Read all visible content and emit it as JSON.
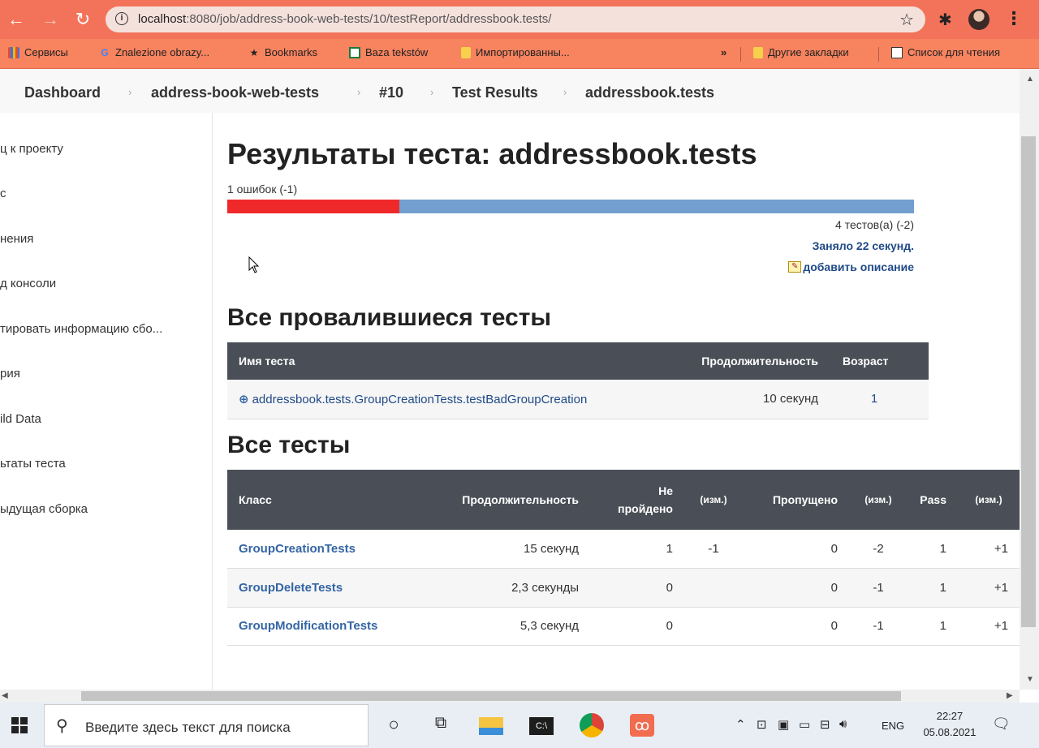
{
  "browser": {
    "url_host": "localhost",
    "url_rest": ":8080/job/address-book-web-tests/10/testReport/addressbook.tests/",
    "bookmarks": {
      "apps": "Сервисы",
      "znalezione": "Znalezione obrazy...",
      "bookmarks": "Bookmarks",
      "baza": "Baza tekstów",
      "imported": "Импортированны...",
      "more": "»",
      "other": "Другие закладки",
      "reading": "Список для чтения"
    }
  },
  "breadcrumb": [
    "Dashboard",
    "address-book-web-tests",
    "#10",
    "Test Results",
    "addressbook.tests"
  ],
  "sidebar": [
    "ц к проекту",
    "с",
    "нения",
    "д консоли",
    "тировать информацию сбо...",
    "рия",
    "ild Data",
    "ьтаты теста",
    "ыдущая сборка"
  ],
  "report": {
    "title": "Результаты теста: addressbook.tests",
    "fail_summary": "1 ошибок (-1)",
    "fail_fraction": 0.25,
    "tests_count": "4 тестов(а) (-2)",
    "duration": "Заняло 22 секунд.",
    "add_description": "добавить описание"
  },
  "failed_section": {
    "title": "Все провалившиеся тесты",
    "headers": [
      "Имя теста",
      "Продолжительность",
      "Возраст"
    ],
    "rows": [
      {
        "name": "addressbook.tests.GroupCreationTests.testBadGroupCreation",
        "duration": "10 секунд",
        "age": "1"
      }
    ]
  },
  "all_section": {
    "title": "Все тесты",
    "headers": [
      "Класс",
      "Продолжительность",
      "Не пройдено",
      "(изм.)",
      "Пропущено",
      "(изм.)",
      "Pass",
      "(изм.)"
    ],
    "rows": [
      {
        "cls": "GroupCreationTests",
        "duration": "15 секунд",
        "fail": "1",
        "fail_diff": "-1",
        "skip": "0",
        "skip_diff": "-2",
        "pass": "1",
        "pass_diff": "+1"
      },
      {
        "cls": "GroupDeleteTests",
        "duration": "2,3 секунды",
        "fail": "0",
        "fail_diff": "",
        "skip": "0",
        "skip_diff": "-1",
        "pass": "1",
        "pass_diff": "+1"
      },
      {
        "cls": "GroupModificationTests",
        "duration": "5,3 секунд",
        "fail": "0",
        "fail_diff": "",
        "skip": "0",
        "skip_diff": "-1",
        "pass": "1",
        "pass_diff": "+1"
      }
    ]
  },
  "taskbar": {
    "search_placeholder": "Введите здесь текст для поиска",
    "lang": "ENG",
    "time": "22:27",
    "date": "05.08.2021"
  }
}
